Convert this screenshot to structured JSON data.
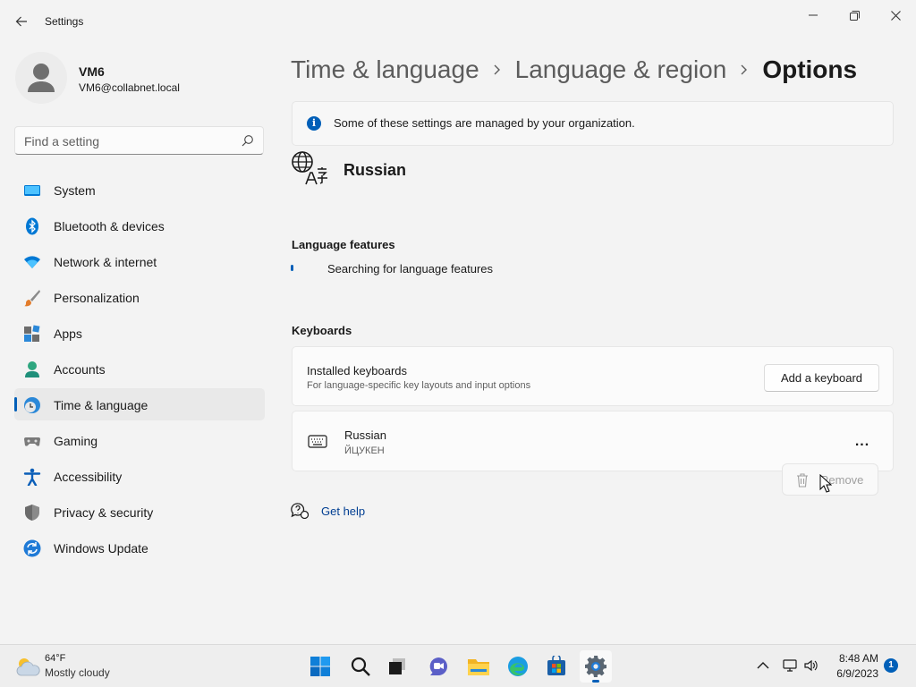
{
  "window": {
    "title": "Settings"
  },
  "user": {
    "name": "VM6",
    "email": "VM6@collabnet.local"
  },
  "search": {
    "placeholder": "Find a setting"
  },
  "sidebar": {
    "items": [
      {
        "label": "System",
        "icon": "system-icon"
      },
      {
        "label": "Bluetooth & devices",
        "icon": "bluetooth-icon"
      },
      {
        "label": "Network & internet",
        "icon": "wifi-icon"
      },
      {
        "label": "Personalization",
        "icon": "brush-icon"
      },
      {
        "label": "Apps",
        "icon": "apps-icon"
      },
      {
        "label": "Accounts",
        "icon": "accounts-icon"
      },
      {
        "label": "Time & language",
        "icon": "time-language-icon",
        "selected": true
      },
      {
        "label": "Gaming",
        "icon": "gamepad-icon"
      },
      {
        "label": "Accessibility",
        "icon": "accessibility-icon"
      },
      {
        "label": "Privacy & security",
        "icon": "shield-icon"
      },
      {
        "label": "Windows Update",
        "icon": "update-icon"
      }
    ]
  },
  "breadcrumb": {
    "items": [
      "Time & language",
      "Language & region",
      "Options"
    ]
  },
  "info": {
    "text": "Some of these settings are managed by your organization."
  },
  "language": {
    "name": "Russian"
  },
  "features": {
    "title": "Language features",
    "status": "Searching for language features"
  },
  "keyboards": {
    "title": "Keyboards",
    "installed_title": "Installed keyboards",
    "installed_sub": "For language-specific key layouts and input options",
    "add_label": "Add a keyboard",
    "items": [
      {
        "name": "Russian",
        "layout": "ЙЦУКЕН"
      }
    ],
    "more_label": "...",
    "remove_label": "Remove"
  },
  "help": {
    "label": "Get help"
  },
  "taskbar": {
    "weather_temp": "64°F",
    "weather_desc": "Mostly cloudy",
    "apps": [
      "start-icon",
      "search-icon",
      "task-view-icon",
      "chat-icon",
      "file-explorer-icon",
      "edge-icon",
      "store-icon",
      "settings-icon"
    ],
    "time": "8:48 AM",
    "date": "6/9/2023",
    "notification_count": "1"
  },
  "colors": {
    "accent": "#005fb8",
    "link": "#003e92",
    "background": "#f3f3f3"
  }
}
